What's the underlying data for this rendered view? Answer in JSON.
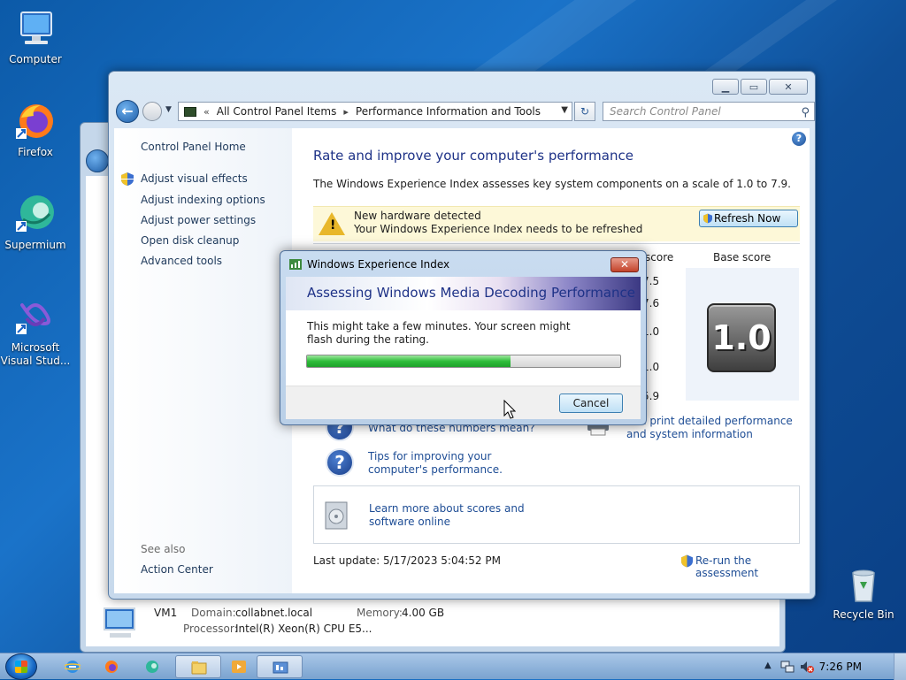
{
  "desktop": {
    "icons": [
      {
        "label": "Computer"
      },
      {
        "label": "Firefox"
      },
      {
        "label": "Supermium"
      },
      {
        "label": "Microsoft Visual Stud..."
      },
      {
        "label": "Recycle Bin"
      }
    ]
  },
  "window": {
    "address": {
      "crumbs": [
        "All Control Panel Items",
        "Performance Information and Tools"
      ],
      "separator_glyph": "«"
    },
    "search_placeholder": "Search Control Panel",
    "left_pane": {
      "home": "Control Panel Home",
      "links": [
        "Adjust visual effects",
        "Adjust indexing options",
        "Adjust power settings",
        "Open disk cleanup",
        "Advanced tools"
      ],
      "see_also_label": "See also",
      "see_also_links": [
        "Action Center"
      ]
    },
    "main": {
      "heading": "Rate and improve your computer's performance",
      "description": "The Windows Experience Index assesses key system components on a scale of 1.0 to 7.9.",
      "banner": {
        "line1": "New hardware detected",
        "line2": "Your Windows Experience Index needs to be refreshed",
        "button": "Refresh Now"
      },
      "table": {
        "subscore_header": "score",
        "base_header": "Base score",
        "subscores": [
          "7.5",
          "7.6",
          "1.0",
          "1.0",
          "5.9"
        ],
        "base_score": "1.0"
      },
      "links": {
        "numbers": "What do these numbers mean?",
        "tips": "Tips for improving your computer's performance.",
        "print": "and print detailed performance and system information",
        "learn": "Learn more about scores and software online"
      },
      "last_update": "Last update: 5/17/2023 5:04:52 PM",
      "rerun": "Re-run the assessment"
    }
  },
  "details_pane": {
    "name": "VM1",
    "domain_label": "Domain:",
    "domain_value": "collabnet.local",
    "memory_label": "Memory:",
    "memory_value": "4.00 GB",
    "processor_label": "Processor:",
    "processor_value": "Intel(R) Xeon(R) CPU E5..."
  },
  "dialog": {
    "title": "Windows Experience Index",
    "header": "Assessing Windows Media Decoding Performance",
    "message": "This might take a few minutes. Your screen might flash during the rating.",
    "progress": 0.65,
    "cancel": "Cancel"
  },
  "taskbar": {
    "clock": "7:26 PM"
  },
  "colors": {
    "link": "#1e4d95",
    "heading": "#1e3287",
    "progress_green": "#2fbd3a",
    "banner_bg": "#fdf8d8"
  }
}
